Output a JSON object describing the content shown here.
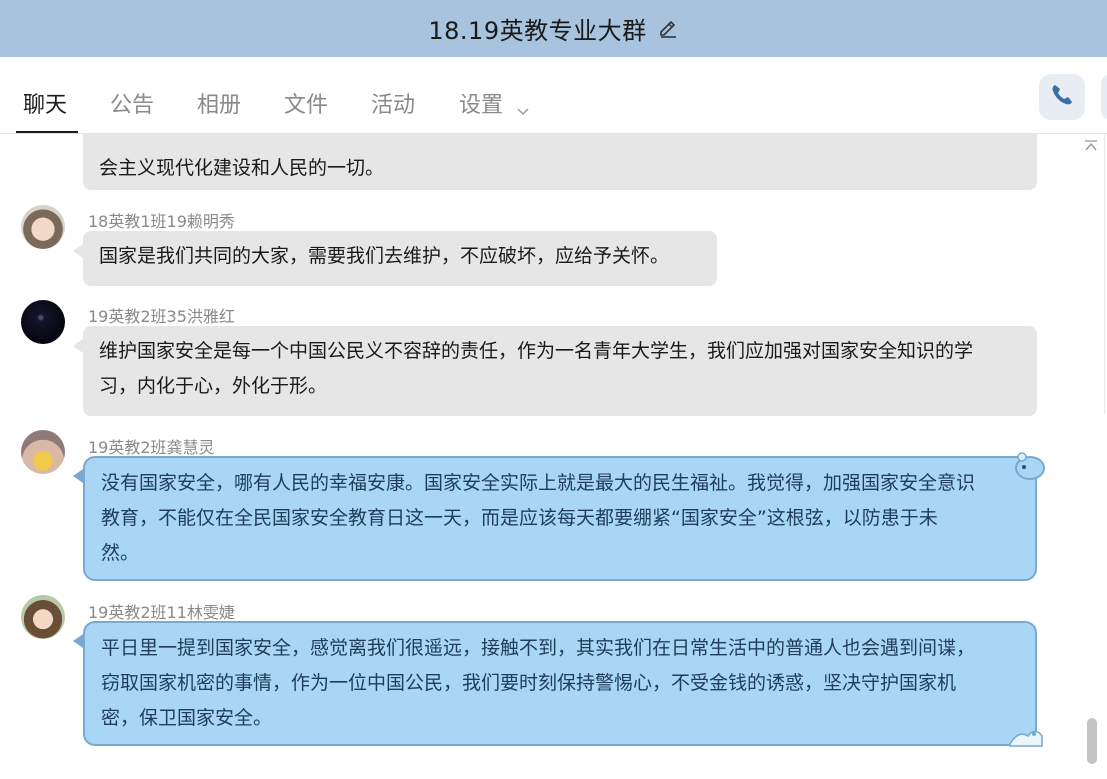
{
  "window": {
    "title": "18.19英教专业大群"
  },
  "tabs": [
    {
      "label": "聊天",
      "active": true
    },
    {
      "label": "公告",
      "active": false
    },
    {
      "label": "相册",
      "active": false
    },
    {
      "label": "文件",
      "active": false
    },
    {
      "label": "活动",
      "active": false
    },
    {
      "label": "设置",
      "active": false
    }
  ],
  "icons": {
    "title_edit": "pencil-icon",
    "settings_dropdown": "chevron-down-icon",
    "call": "phone-icon",
    "scroll_up": "chevron-up-icon"
  },
  "colors": {
    "title_bar": "#a7c3de",
    "gray_bubble": "#e6e6e6",
    "blue_bubble": "#a9d6f5",
    "blue_border": "#79a9cf"
  },
  "messages": [
    {
      "sender": "",
      "text": "会主义现代化建设和人民的一切。",
      "style": "gray"
    },
    {
      "sender": "18英教1班19赖明秀",
      "text": "国家是我们共同的大家，需要我们去维护，不应破坏，应给予关怀。",
      "style": "gray"
    },
    {
      "sender": "19英教2班35洪雅红",
      "text_line1": "维护国家安全是每一个中国公民义不容辞的责任，作为一名青年大学生，我们应加强对国家安全知识的学",
      "text_line2": "习，内化于心，外化于形。",
      "style": "gray"
    },
    {
      "sender": "19英教2班龚慧灵",
      "text_line1": "没有国家安全，哪有人民的幸福安康。国家安全实际上就是最大的民生福祉。我觉得，加强国家安全意识",
      "text_line2": "教育，不能仅在全民国家安全教育日这一天，而是应该每天都要绷紧“国家安全”这根弦，以防患于未",
      "text_line3": "然。",
      "style": "blue"
    },
    {
      "sender": "19英教2班11林雯婕",
      "text_line1": "平日里一提到国家安全，感觉离我们很遥远，接触不到，其实我们在日常生活中的普通人也会遇到间谍，",
      "text_line2": "窃取国家机密的事情，作为一位中国公民，我们要时刻保持警惕心，不受金钱的诱惑，坚决守护国家机",
      "text_line3": "密，保卫国家安全。",
      "style": "blue"
    }
  ]
}
